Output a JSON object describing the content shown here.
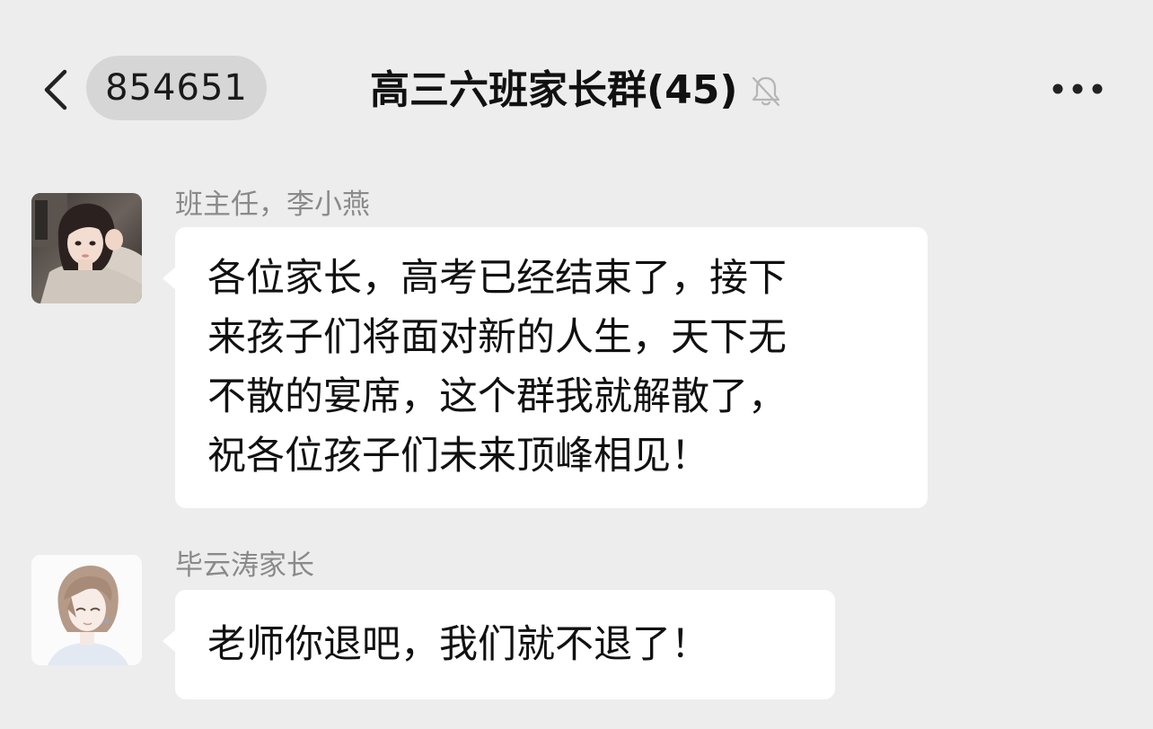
{
  "header": {
    "back_icon": "chevron-left-icon",
    "unread_count": "854651",
    "title": "高三六班家长群(45)",
    "mute_icon": "bell-slash-icon",
    "more_icon": "more-dots-icon"
  },
  "colors": {
    "background": "#ededed",
    "bubble": "#ffffff",
    "badge": "#d6d6d6",
    "sender_name": "#8a8a8a"
  },
  "messages": [
    {
      "sender": "班主任，李小燕",
      "avatar": "teacher-avatar",
      "lines": [
        "各位家长，高考已经结束了，接下",
        "来孩子们将面对新的人生，天下无",
        "不散的宴席，这个群我就解散了，",
        "祝各位孩子们未来顶峰相见！"
      ]
    },
    {
      "sender": "毕云涛家长",
      "avatar": "parent-avatar",
      "lines": [
        "老师你退吧，我们就不退了！"
      ]
    }
  ]
}
